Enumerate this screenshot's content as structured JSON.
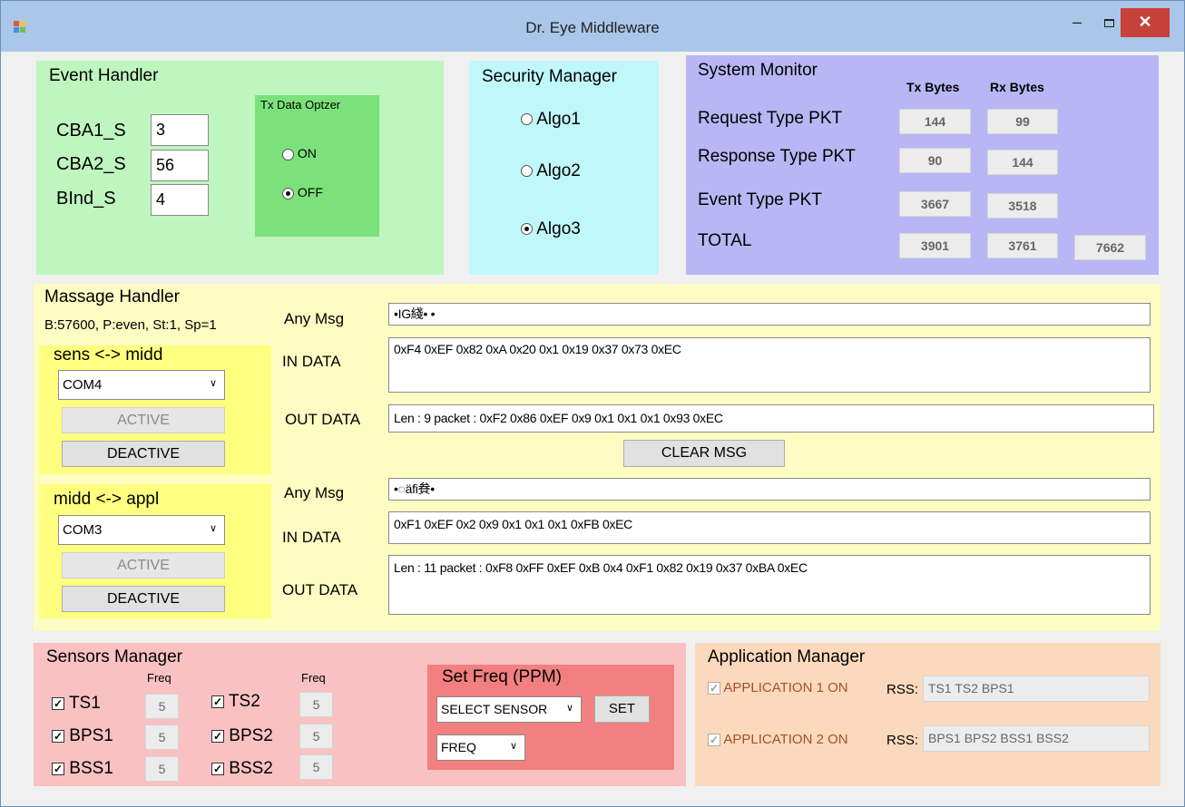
{
  "window": {
    "title": "Dr. Eye Middleware",
    "minimize_label": "–",
    "close_label": "✕"
  },
  "event_handler": {
    "title": "Event Handler",
    "fields": [
      {
        "label": "CBA1_S",
        "value": "3"
      },
      {
        "label": "CBA2_S",
        "value": "56"
      },
      {
        "label": "BInd_S",
        "value": "4"
      }
    ],
    "tx_optimizer": {
      "title": "Tx Data Optzer",
      "on_label": "ON",
      "off_label": "OFF",
      "selected": "OFF"
    }
  },
  "security_manager": {
    "title": "Security Manager",
    "options": [
      "Algo1",
      "Algo2",
      "Algo3"
    ],
    "selected": "Algo3"
  },
  "system_monitor": {
    "title": "System Monitor",
    "col_tx": "Tx Bytes",
    "col_rx": "Rx Bytes",
    "rows": [
      {
        "label": "Request Type PKT",
        "tx": "144",
        "rx": "99"
      },
      {
        "label": "Response Type PKT",
        "tx": "90",
        "rx": "144"
      },
      {
        "label": "Event Type PKT",
        "tx": "3667",
        "rx": "3518"
      },
      {
        "label": "TOTAL",
        "tx": "3901",
        "rx": "3761",
        "sum": "7662"
      }
    ]
  },
  "message_handler": {
    "title": "Massage Handler",
    "serial_info": "B:57600, P:even, St:1, Sp=1",
    "sens_midd": {
      "title": "sens <-> midd",
      "port": "COM4",
      "active_label": "ACTIVE",
      "deactive_label": "DEACTIVE"
    },
    "midd_appl": {
      "title": "midd <-> appl",
      "port": "COM3",
      "active_label": "ACTIVE",
      "deactive_label": "DEACTIVE"
    },
    "any_msg_label": "Any Msg",
    "in_data_label": "IN DATA",
    "out_data_label": "OUT DATA",
    "upper": {
      "any_msg": "•IG綫• •",
      "in_data": "0xF4  0xEF  0x82  0xA  0x20  0x1  0x19  0x37  0x73  0xEC",
      "out_data": "Len : 9 packet : 0xF2  0x86  0xEF  0x9  0x1  0x1  0x1  0x93  0xEC"
    },
    "clear_label": "CLEAR MSG",
    "lower": {
      "any_msg": "•◌äfi貵•",
      "in_data": "0xF1  0xEF  0x2  0x9  0x1  0x1  0x1  0xFB  0xEC",
      "out_data": "Len : 11 packet : 0xF8  0xFF  0xEF  0xB  0x4  0xF1  0x82  0x19  0x37  0xBA  0xEC"
    }
  },
  "sensors_manager": {
    "title": "Sensors Manager",
    "freq_label": "Freq",
    "sensors": [
      {
        "name": "TS1",
        "freq": "5"
      },
      {
        "name": "BPS1",
        "freq": "5"
      },
      {
        "name": "BSS1",
        "freq": "5"
      },
      {
        "name": "TS2",
        "freq": "5"
      },
      {
        "name": "BPS2",
        "freq": "5"
      },
      {
        "name": "BSS2",
        "freq": "5"
      }
    ],
    "set_freq": {
      "title": "Set Freq (PPM)",
      "sensor_select": "SELECT SENSOR",
      "freq_select": "FREQ",
      "set_label": "SET"
    }
  },
  "application_manager": {
    "title": "Application Manager",
    "rss_label": "RSS:",
    "apps": [
      {
        "label": "APPLICATION 1 ON",
        "rss": "TS1 TS2 BPS1"
      },
      {
        "label": "APPLICATION 2 ON",
        "rss": "BPS1 BPS2 BSS1 BSS2"
      }
    ]
  },
  "colors": {
    "event_handler_bg": "#bff5bf",
    "tx_optimizer_bg": "#7be27b",
    "security_bg": "#bff7fb",
    "monitor_bg": "#b9b6f5",
    "message_bg": "#fdfcc3",
    "port_group_bg": "#ffff7f",
    "sensors_bg": "#f9c1c1",
    "set_freq_bg": "#f28080",
    "app_manager_bg": "#fbd9bd"
  }
}
